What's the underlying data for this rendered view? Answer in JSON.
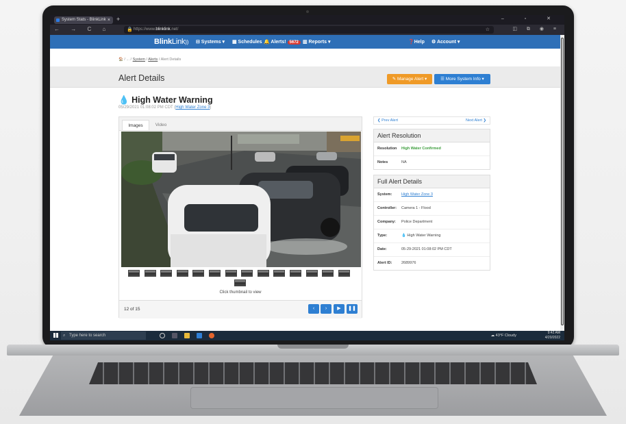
{
  "browser": {
    "tab_title": "System Stats - BlinkLink",
    "tab_close": "×",
    "new_tab": "+",
    "window_controls": "–  ▫  ✕",
    "nav_buttons": "← → C ⌂",
    "url_prefix": "https://www.",
    "url_domain": "blinklink",
    "url_suffix": ".net/",
    "right_icons": "◫ ⧉ ◉ ≡"
  },
  "appnav": {
    "brand_bold": "Blink",
    "brand_rest": "Link",
    "brand_mark": "))",
    "systems": "⊟ Systems ▾",
    "schedules": "▦ Schedules",
    "alerts": "🔔 Alerts!",
    "alerts_count": "5672",
    "reports": "▥ Reports ▾",
    "help": "❓Help",
    "account": "⚙ Account ▾"
  },
  "breadcrumb": {
    "home": "🏠",
    "ellipsis": "/ ... /",
    "system": "System",
    "alerts": "Alerts",
    "current": "Alert Details"
  },
  "page": {
    "title": "Alert Details",
    "manage_alert": "✎ Manage Alert ▾",
    "more_info": "☰ More System Info ▾"
  },
  "alert": {
    "title": "High Water Warning",
    "datetime": "05/29/2021 01:08:02 PM CDT",
    "zone_link": "High Water Zone 3"
  },
  "media": {
    "tab_images": "Images",
    "tab_video": "Video",
    "thumb_count": 15,
    "click_text": "Click thumbnail to view",
    "counter": "12 of 15",
    "controls": [
      "‹",
      "›",
      "▶",
      "❚❚"
    ]
  },
  "sidebar": {
    "prev": "❮  Prev Alert",
    "next": "Next Alert  ❯",
    "resolution_card": {
      "title": "Alert Resolution",
      "rows": [
        {
          "k": "Resolution",
          "v": "High Water Confirmed"
        },
        {
          "k": "Notes",
          "v": "NA"
        }
      ]
    },
    "details_card": {
      "title": "Full Alert Details",
      "rows": [
        {
          "k": "System:",
          "v": "High Water Zone 3"
        },
        {
          "k": "Controller:",
          "v": "Camera 1 - Flood"
        },
        {
          "k": "Company:",
          "v": "Police Department"
        },
        {
          "k": "Type:",
          "v": "💧 High Water Warning"
        },
        {
          "k": "Date:",
          "v": "05-29-2021 01:08:02 PM CDT"
        },
        {
          "k": "Alert ID:",
          "v": "2689976"
        }
      ]
    }
  },
  "taskbar": {
    "search_placeholder": "Type here to search",
    "weather": "☁ 43°F Cloudy",
    "time": "9:42 AM",
    "date": "4/20/2022"
  },
  "colors": {
    "app_nav": "#2e6fb7",
    "accent_orange": "#ef9a27",
    "accent_blue": "#2e7fd2",
    "confirmed_green": "#3c9d3c"
  }
}
